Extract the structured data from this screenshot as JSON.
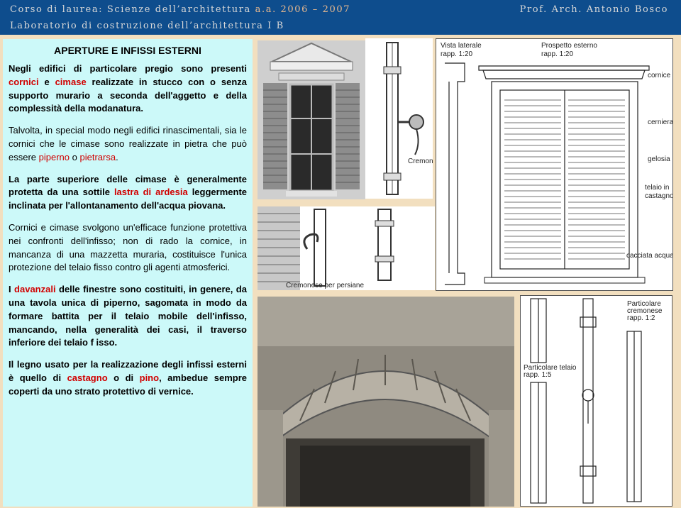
{
  "header": {
    "course_prefix": "Corso di laurea: Scienze dell’architettura",
    "academic_year": "a.a. 2006 – 2007",
    "professor": "Prof. Arch. Antonio Bosco",
    "lab": "Laboratorio di costruzione dell’architettura I B"
  },
  "colors": {
    "header_bg": "#0e4d8d",
    "text_panel_bg": "#ccf9f9",
    "page_bg": "#f2dfbf",
    "highlight": "#d10000"
  },
  "title": "APERTURE E INFISSI ESTERNI",
  "paragraphs": {
    "p1": {
      "a": "Negli edifici di particolare pregio sono presenti ",
      "b": "cornici",
      "c": " e ",
      "d": "cimase",
      "e": " realizzate in stucco con o senza supporto murario a seconda dell'aggetto e della complessità della modanatura."
    },
    "p2": {
      "a": "Talvolta, in special modo negli edifici rinascimentali, sia le cornici che le cimase sono realizzate in pietra che può essere ",
      "b": "piperno",
      "c": " o ",
      "d": "pietrarsa",
      "e": "."
    },
    "p3": {
      "a": "La parte superiore delle cimase è generalmente protetta da una sottile ",
      "b": "lastra di ardesia",
      "c": " leggermente inclinata per l'allontanamento dell'acqua piovana."
    },
    "p4": "Cornici e cimase svolgono un'efficace funzione protettiva nei confronti dell'infisso; non di rado la cornice, in mancanza di una mazzetta muraria, costituisce l'unica protezione del telaio fisso contro gli agenti atmosferici.",
    "p5": {
      "a": "I ",
      "b": "davanzali",
      "c": " delle finestre sono costituiti, in genere, da una tavola unica di piperno, sagomata in modo da formare battita per il telaio mobile dell'infisso, mancando, nella generalità dei casi, il traverso inferiore dei telaio f isso."
    },
    "p6": {
      "a": "Il legno usato per la realizzazione degli infissi esterni è quello di ",
      "b": "castagno",
      "c": " o di ",
      "d": "pino",
      "e": ", ambedue sempre coperti da uno strato protettivo di vernice."
    }
  },
  "drawing_labels": {
    "vista_laterale": "Vista laterale",
    "vista_laterale_scale": "rapp. 1:20",
    "prospetto": "Prospetto esterno",
    "prospetto_scale": "rapp. 1:20",
    "cornice": "cornice",
    "cerniera": "cerniera",
    "gelosia": "gelosia",
    "telaio": "telaio in",
    "castagno": "castagno",
    "cacciata": "cacciata acqua",
    "particolare_cremonese": "Particolare",
    "cremonese": "cremonese",
    "cremonese_scale": "rapp. 1:2",
    "particolare_telaio": "Particolare telaio",
    "telaio_scale": "rapp. 1:5",
    "photo_caption": "Cremonese",
    "photo_caption2": "Cremonese per persiane"
  }
}
